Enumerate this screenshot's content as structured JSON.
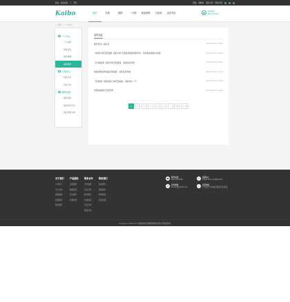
{
  "topbar": {
    "welcome": "您好，欢迎来到",
    "sep": "|",
    "login": "登录",
    "links": [
      "帮助",
      "购物车",
      "我的订单",
      "网站导航"
    ]
  },
  "header": {
    "logo": "Kaibo",
    "nav": [
      "首页",
      "礼物",
      "团购",
      "一元购",
      "新品推荐",
      "日用品",
      "会员专区"
    ],
    "hotline_label": "服务热线：",
    "hotline_number": "020-31970166"
  },
  "breadcrumb": {
    "home": "首页",
    "sep": ">",
    "current": "个人中心"
  },
  "sidebar": {
    "sections": [
      {
        "title": "个人中心",
        "items": [
          "个人资料",
          "修改密码",
          "我的收藏",
          "站内消息"
        ],
        "active": 3
      },
      {
        "title": "订单中心",
        "items": [
          "我的订单",
          "退货订单"
        ],
        "active": -1
      },
      {
        "title": "我的优惠",
        "items": [
          "我的优惠",
          "我的积分记录",
          "我的优惠卡券"
        ],
        "active": -1
      }
    ]
  },
  "content": {
    "title": "站内消息",
    "messages": [
      {
        "text": "账号登录入请信息",
        "date": "2017-08-22 10:40:26"
      },
      {
        "text": "【退款订单已经完成】您的订单 已经退款到您的账号中，请查收您的账户余额！",
        "date": "2017-08-22 10:40:26"
      },
      {
        "text": "【订单发货】您的订单已经发货，请您注意查收",
        "date": "2017-08-22 10:40:26"
      },
      {
        "text": "您最新购买的商品已经发货，请您注意查收",
        "date": "2017-08-22 10:40:26"
      },
      {
        "text": "【已成功】您购买的订单已经完成，请您评价一下",
        "date": "2017-08-22 10:40:26"
      },
      {
        "text": "您现在的账户已经开通",
        "date": "2017-08-22 10:40:26"
      }
    ],
    "pager": [
      "1",
      "2",
      "3",
      "4",
      "5",
      "6",
      "...",
      "10",
      "下一页"
    ]
  },
  "footer": {
    "columns": [
      {
        "title": "关于我们",
        "items": [
          "公司简介",
          "企业文化",
          "品牌故事",
          "商城理念",
          "联系我们"
        ]
      },
      {
        "title": "产品服务",
        "items": [
          "定制服务",
          "物流配送",
          "售后服务",
          "商城优惠"
        ]
      },
      {
        "title": "联系合作",
        "items": [
          "合作加盟",
          "商家合作",
          "联系我们",
          "商城招商",
          "门店合作",
          "联盟合作"
        ]
      },
      {
        "title": "联系我们",
        "items": [
          "联系我们",
          "联系地址",
          "邮件联系",
          "意见反馈"
        ]
      }
    ],
    "contact": [
      {
        "label": "服务热线",
        "value": "020-31970166"
      },
      {
        "label": "客服QQ",
        "value": "1040478111  2168967162"
      },
      {
        "label": "商务邮箱",
        "value": "service@ds123.com"
      },
      {
        "label": "商务地址",
        "value": "广东省广州市白云区白云大道北"
      }
    ],
    "copyright": "Copyright © 2002-2017  凯博商城  凯博网络科技有限公司版权所有"
  }
}
